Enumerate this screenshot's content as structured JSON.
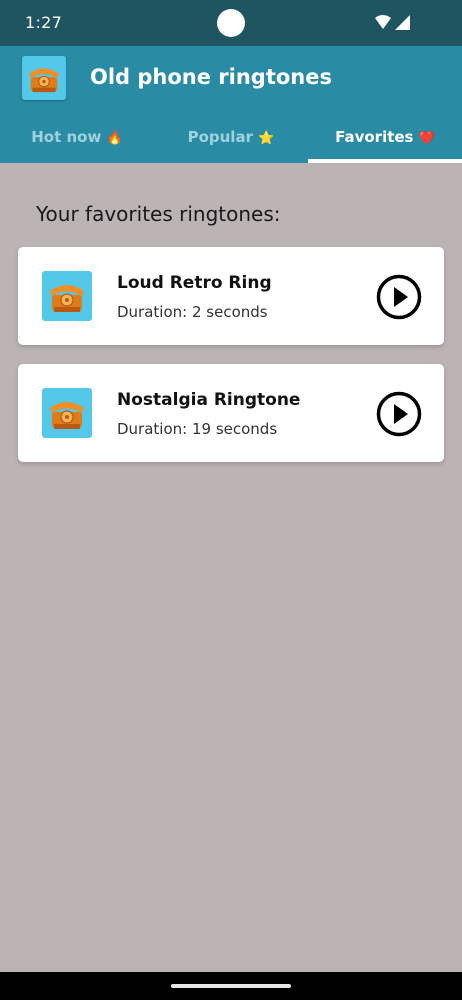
{
  "status_bar": {
    "time": "1:27",
    "icons": [
      "wifi-icon",
      "cellular-signal-icon"
    ]
  },
  "app_bar": {
    "title": "Old phone ringtones",
    "icon": "retro-phone-icon",
    "accent_color": "#2a8ba4"
  },
  "tabs": [
    {
      "label": "Hot now",
      "emoji": "🔥",
      "active": false
    },
    {
      "label": "Popular",
      "emoji": "⭐",
      "active": false
    },
    {
      "label": "Favorites",
      "emoji": "❤️",
      "active": true
    }
  ],
  "main": {
    "heading": "Your favorites ringtones:",
    "ringtones": [
      {
        "title": "Loud Retro Ring",
        "duration": "Duration: 2 seconds",
        "icon": "retro-phone-icon",
        "action_icon": "play-icon"
      },
      {
        "title": "Nostalgia Ringtone",
        "duration": "Duration: 19 seconds",
        "icon": "retro-phone-icon",
        "action_icon": "play-icon"
      }
    ]
  }
}
